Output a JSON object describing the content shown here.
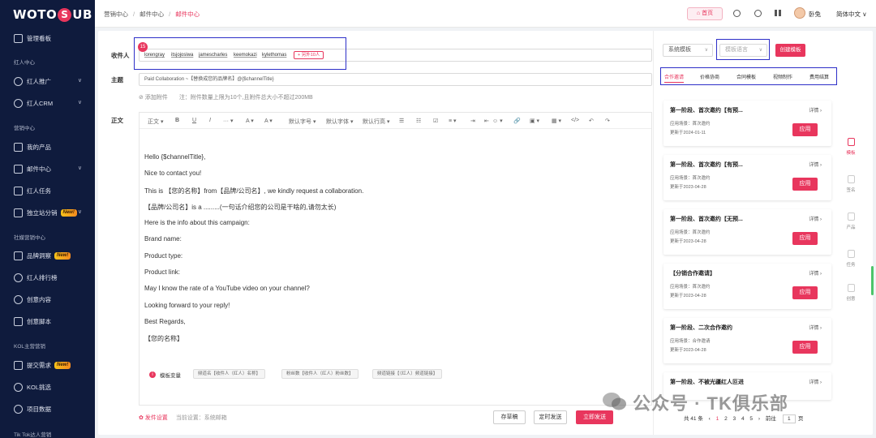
{
  "brand": {
    "logo_left": "WOTO",
    "logo_mid": "S",
    "logo_right": "UB",
    "accent": "#e8365d",
    "sidebar_bg": "#0f1b3d"
  },
  "sidebar": {
    "dashboard": "管理看板",
    "group_kol": "红人中心",
    "kol_promo": "红人推广",
    "kol_crm": "红人CRM",
    "group_marketing": "营销中心",
    "my_products": "我的产品",
    "mail_center": "邮件中心",
    "kol_tasks": "红人任务",
    "standalone": "独立站分销",
    "group_social": "社媒营销中心",
    "brand_insight": "品牌洞察",
    "kol_rank": "红人排行榜",
    "creative_content": "创意内容",
    "creative_script": "创意脚本",
    "group_kolmain": "KOL主营营销",
    "submit_req": "提交需求",
    "kol_select": "KOL挑选",
    "project_data": "项目数据",
    "group_tiktok": "Tik Tok达人营销",
    "new_badge": "New!"
  },
  "topbar": {
    "crumb1": "营销中心",
    "crumb2": "邮件中心",
    "crumb3": "邮件中心",
    "home": "⌂ 首页",
    "user": "卧兔",
    "lang": "简体中文 ∨"
  },
  "form": {
    "recipients_label": "收件人",
    "recipient_count": "15",
    "recipients": [
      "lorengray",
      "itsjojosiwa",
      "jamescharles",
      "keemokazi",
      "kylethomas"
    ],
    "more": "+ 另外10人",
    "subject_label": "主题",
    "subject_value": "Paid Collaboration ~【替换成您的品牌名】@{$channelTitle}",
    "attach_label": "⊘ 添加附件",
    "attach_note": "注：附件数量上限为10个,且附件总大小不超过200MB",
    "body_label": "正文"
  },
  "toolbar": {
    "t1": "正文 ▾",
    "t2": "B",
    "t3": "U",
    "t4": "I",
    "t5": "··· ▾",
    "t6": "A ▾",
    "t7": "A ▾",
    "t8": "默认字号 ▾",
    "t9": "默认字体 ▾",
    "t10": "默认行高 ▾",
    "t11": "☰",
    "t12": "☷",
    "t13": "☑",
    "t14": "≡ ▾",
    "t15": "⇥",
    "t16": "⇤",
    "t17": "☺ ▾",
    "t18": "🔗",
    "t19": "▣ ▾",
    "t20": "▦ ▾",
    "t21": "</>",
    "t22": "↶",
    "t23": "↷"
  },
  "body": {
    "l1": "Hello {$channelTitle},",
    "l2": "Nice to contact you!",
    "l3": "This is 【您的名称】from【品牌/公司名】, we kindly request a collaboration.",
    "l4": "【品牌/公司名】is a .........(一句话介绍您的公司是干啥的,请勿太长)",
    "l5": "Here is the info about this campaign:",
    "l6": "Brand name:",
    "l7": "Product type:",
    "l8": "Product link:",
    "l9": "May I know the rate of a YouTube video on your channel?",
    "l10": "Looking forward to your reply!",
    "l11": "Best Regards,",
    "l12": "【您的名称】"
  },
  "vars": {
    "label": "模板变量",
    "v1": "频道名【收件人（红人）名称】",
    "v2": "粉丝数【收件人（红人）粉丝数】",
    "v3": "频道链接【（红人）频道链接】"
  },
  "footer": {
    "send_settings": "✿ 发件设置",
    "current_setting": "当前设置：系统邮箱",
    "draft": "存草稿",
    "scheduled": "定时发送",
    "send_now": "立即发送"
  },
  "right": {
    "system_template": "系统模板",
    "template_lang": "模板语言",
    "create_template": "创建模板",
    "tabs": [
      "合作邀请",
      "价格协商",
      "合同模板",
      "视频制作",
      "费用结算"
    ],
    "detail": "详情 ›",
    "apply": "应用",
    "templates": [
      {
        "title": "第一阶段、首次邀约【有预...",
        "scene": "应用场景：首次邀约",
        "date": "更新于2024-01-11"
      },
      {
        "title": "第一阶段、首次邀约【有预...",
        "scene": "应用场景：首次邀约",
        "date": "更新于2023-04-28"
      },
      {
        "title": "第一阶段、首次邀约【无预...",
        "scene": "应用场景：首次邀约",
        "date": "更新于2023-04-28"
      },
      {
        "title": "【分销合作邀请】",
        "scene": "应用场景：首次邀约",
        "date": "更新于2023-04-28"
      },
      {
        "title": "第一阶段、二次合作邀约",
        "scene": "应用场景：合作邀请",
        "date": "更新于2023-04-28"
      },
      {
        "title": "第一阶段、不被光疆红人叵进",
        "scene": "",
        "date": ""
      }
    ],
    "pager": {
      "total": "共 41 条",
      "prev": "‹",
      "p1": "1",
      "p2": "2",
      "p3": "3",
      "p4": "4",
      "p5": "5",
      "next": "›",
      "goto": "前往",
      "page": "1",
      "unit": "页"
    }
  },
  "strip": {
    "s1": "模板",
    "s2": "签名",
    "s3": "产品",
    "s4": "任务",
    "s5": "创意"
  },
  "watermark": "公众号 · TK俱乐部"
}
